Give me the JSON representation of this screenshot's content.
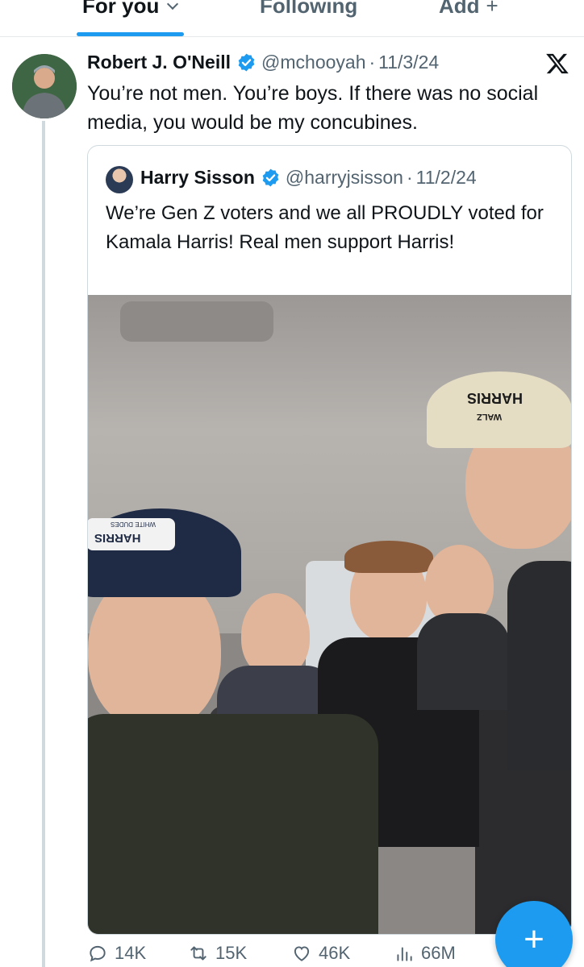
{
  "tabs": [
    {
      "label": "For you",
      "active": true
    },
    {
      "label": "Following",
      "active": false
    },
    {
      "label": "Add",
      "active": false
    }
  ],
  "post": {
    "author_name": "Robert J. O'Neill",
    "handle": "@mchooyah",
    "separator": "·",
    "date": "11/3/24",
    "text": "You’re not men. You’re boys. If there was no social media, you would be my concubines.",
    "verified": true
  },
  "quote": {
    "author_name": "Harry Sisson",
    "handle": "@harryjsisson",
    "separator": "·",
    "date": "11/2/24",
    "text": "We’re Gen Z voters and we all PROUDLY voted for Kamala Harris! Real men support Harris!",
    "verified": true,
    "media": {
      "cap_text_left": "HARRIS",
      "cap_subtext_left": "WHITE DUDES",
      "cap_text_right": "HARRIS",
      "cap_subtext_right": "WALZ"
    }
  },
  "actions": {
    "replies": "14K",
    "reposts": "15K",
    "likes": "46K",
    "views": "66M"
  },
  "colors": {
    "accent": "#1d9bf0",
    "text": "#0f1419",
    "secondary": "#536471",
    "border": "#cfd9de"
  },
  "fab_label": "+"
}
